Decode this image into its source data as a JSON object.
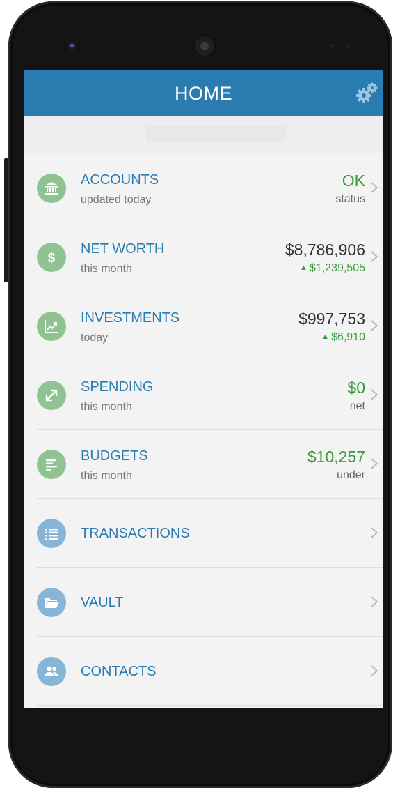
{
  "header": {
    "title": "HOME"
  },
  "rows": [
    {
      "title": "ACCOUNTS",
      "subtitle": "updated today",
      "value": "OK",
      "value_sub": "status"
    },
    {
      "title": "NET WORTH",
      "subtitle": "this month",
      "value": "$8,786,906",
      "value_sub": "$1,239,505"
    },
    {
      "title": "INVESTMENTS",
      "subtitle": "today",
      "value": "$997,753",
      "value_sub": "$6,910"
    },
    {
      "title": "SPENDING",
      "subtitle": "this month",
      "value": "$0",
      "value_sub": "net"
    },
    {
      "title": "BUDGETS",
      "subtitle": "this month",
      "value": "$10,257",
      "value_sub": "under"
    },
    {
      "title": "TRANSACTIONS"
    },
    {
      "title": "VAULT"
    },
    {
      "title": "CONTACTS"
    }
  ],
  "colors": {
    "header": "#2a7cb0",
    "accent_text": "#2a7cb0",
    "positive": "#3a9a3a",
    "icon_green": "#8fc492",
    "icon_blue": "#86b5d6"
  },
  "icons": {
    "settings": "gears-icon",
    "accounts": "bank-icon",
    "net_worth": "dollar-icon",
    "investments": "chart-icon",
    "spending": "arrows-icon",
    "budgets": "lines-icon",
    "transactions": "list-icon",
    "vault": "folder-icon",
    "contacts": "people-icon",
    "change_up": "triangle-up-icon",
    "row_arrow": "chevron-right-icon"
  }
}
